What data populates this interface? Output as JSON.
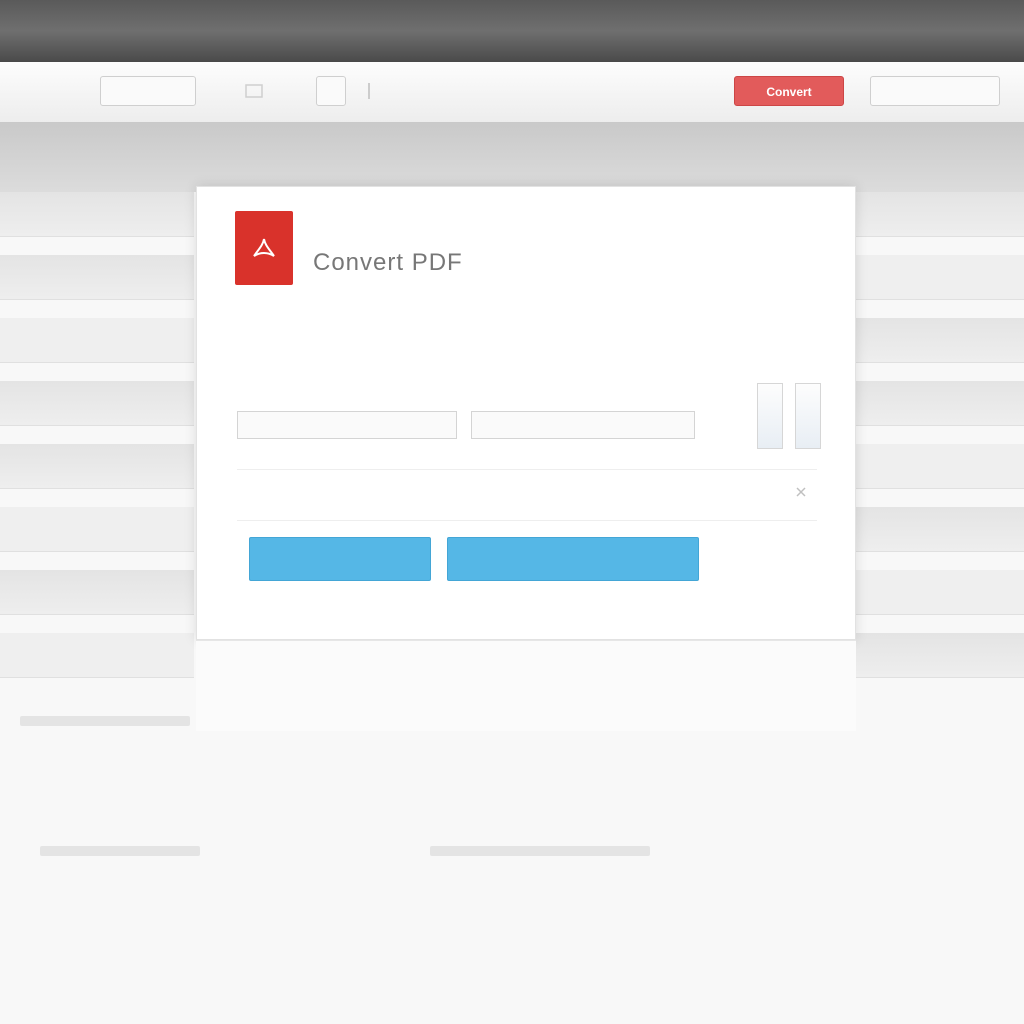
{
  "toolbar": {
    "menu_label": "",
    "text_a": "",
    "text_b": "",
    "red_button_label": "Convert",
    "right_label": ""
  },
  "dialog": {
    "title": "Convert PDF",
    "desc_small": "",
    "desc_main": "",
    "desc_sub": "",
    "field_label": "",
    "field_a_value": "",
    "field_b_value": "",
    "option_a": "",
    "option_b": "",
    "option_c": "",
    "primary_button": "",
    "secondary_button": ""
  },
  "footer": {
    "text": ""
  },
  "colors": {
    "accent_blue": "#55b7e6",
    "brand_red": "#d9322b",
    "toolbar_red": "#e25b5b"
  },
  "icons": {
    "logo": "acrobat-pdf-icon"
  }
}
